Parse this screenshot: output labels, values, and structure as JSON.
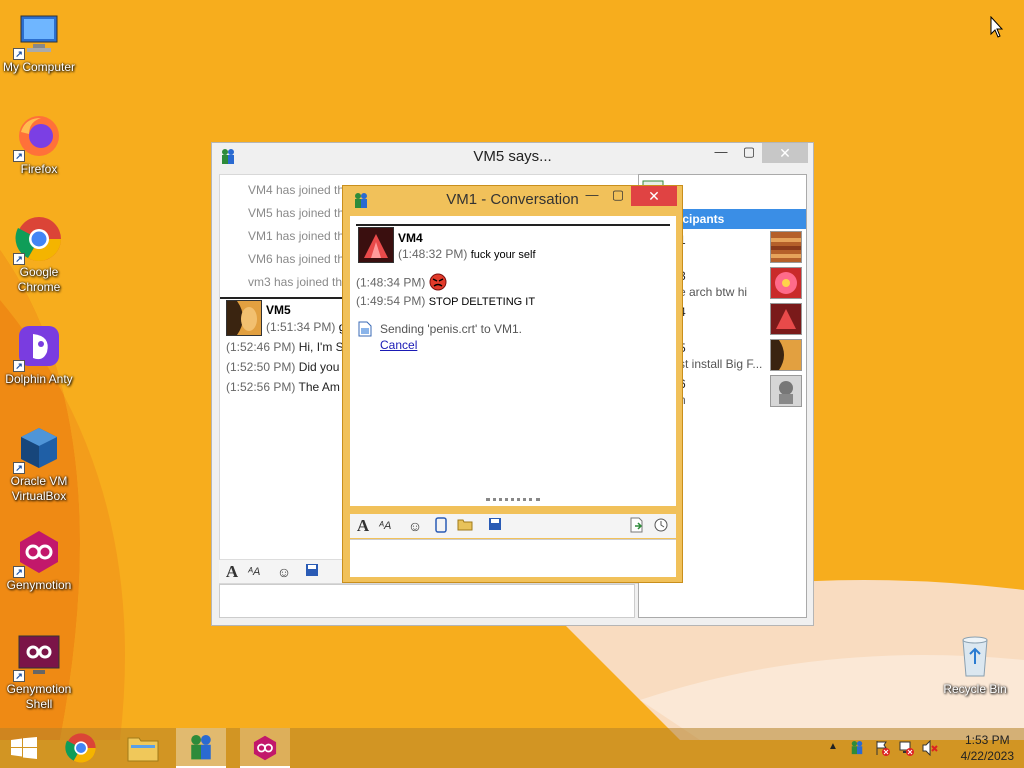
{
  "desktop": {
    "icons": [
      {
        "label": "My Computer"
      },
      {
        "label": "Firefox"
      },
      {
        "label": "Google Chrome"
      },
      {
        "label": "Dolphin Anty"
      },
      {
        "label": "Oracle VM VirtualBox"
      },
      {
        "label": "Genymotion"
      },
      {
        "label": "Genymotion Shell"
      },
      {
        "label": "Recycle Bin"
      }
    ]
  },
  "vm5_window": {
    "title": "VM5 says...",
    "join_lines": [
      "VM4 has joined th",
      "VM5 has joined th",
      "VM1 has joined th",
      "VM6 has joined th",
      "vm3 has joined th"
    ],
    "sender_name": "VM5",
    "sender_time": "(1:51:34 PM)",
    "sender_text": "g",
    "messages": [
      {
        "time": "(1:52:46 PM)",
        "text": "Hi, I'm S"
      },
      {
        "time": "(1:52:50 PM)",
        "text": "Did you"
      },
      {
        "time": "(1:52:56 PM)",
        "text": "The Am"
      }
    ],
    "participants_header": "icipants",
    "participants": [
      {
        "name": "1",
        "status": ""
      },
      {
        "name": "3",
        "status": "e arch btw hi"
      },
      {
        "name": "4",
        "status": ""
      },
      {
        "name": "5",
        "status": "st install Big F..."
      },
      {
        "name": "6",
        "status": "n"
      }
    ]
  },
  "vm1_window": {
    "title": "VM1 - Conversation",
    "sender_name": "VM4",
    "messages": [
      {
        "time": "(1:48:32 PM)",
        "text": "fuck your self"
      },
      {
        "time": "(1:48:34 PM)",
        "text": ""
      },
      {
        "time": "(1:49:54 PM)",
        "text": "STOP DELTETING IT"
      }
    ],
    "file_transfer": "Sending 'penis.crt' to VM1.",
    "cancel_label": "Cancel"
  },
  "taskbar": {
    "time": "1:53 PM",
    "date": "4/22/2023"
  }
}
